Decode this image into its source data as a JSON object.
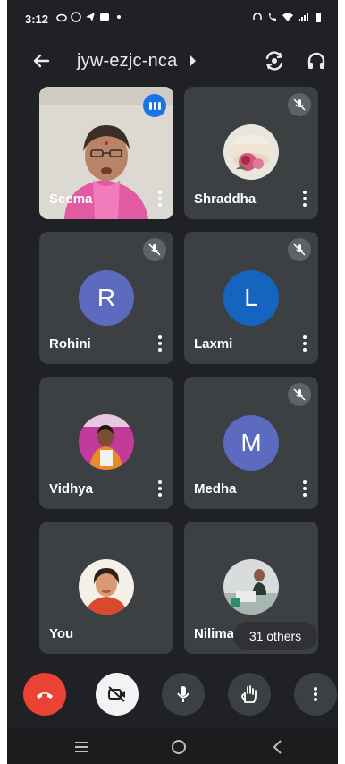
{
  "status_bar": {
    "time": "3:12"
  },
  "meeting": {
    "code": "jyw-ezjc-nca"
  },
  "participants": [
    {
      "name": "Seema",
      "type": "video",
      "speaking": true
    },
    {
      "name": "Shraddha",
      "type": "photo",
      "muted": true
    },
    {
      "name": "Rohini",
      "type": "letter",
      "initial": "R",
      "color": "#5c6bc0",
      "muted": true
    },
    {
      "name": "Laxmi",
      "type": "letter",
      "initial": "L",
      "color": "#1565c0",
      "muted": true
    },
    {
      "name": "Vidhya",
      "type": "photo",
      "muted": false
    },
    {
      "name": "Medha",
      "type": "letter",
      "initial": "M",
      "color": "#5c6bc0",
      "muted": true
    },
    {
      "name": "You",
      "type": "photo",
      "muted": false
    },
    {
      "name": "Nilima",
      "type": "photo",
      "muted": false
    }
  ],
  "others_badge": "31 others",
  "colors": {
    "background": "#202124",
    "tile": "#3c4043",
    "end_call": "#ea4335",
    "speaking": "#1a73e8"
  },
  "icons": {
    "back": "arrow-left-icon",
    "switch_camera": "switch-camera-icon",
    "audio_output": "headphones-icon",
    "end_call": "phone-hangup-icon",
    "camera": "camera-off-icon",
    "mic": "microphone-icon",
    "raise_hand": "hand-icon",
    "more": "more-vert-icon"
  }
}
